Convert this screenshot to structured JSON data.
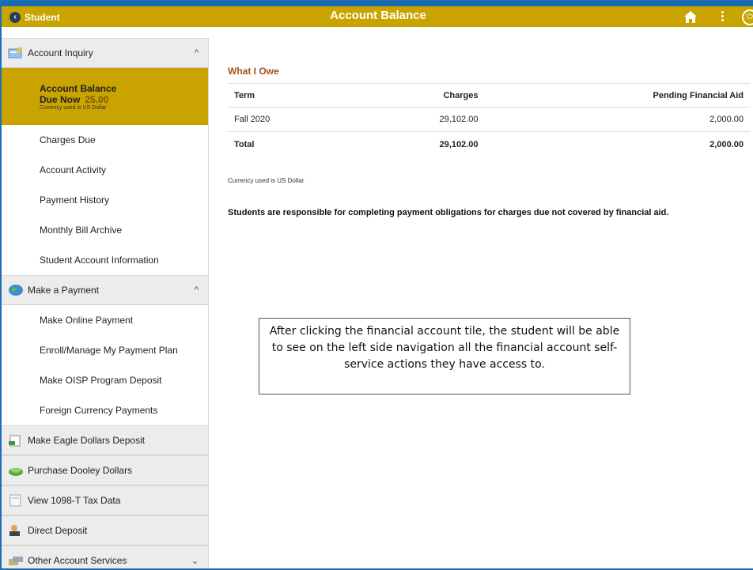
{
  "header": {
    "back_label": "Student",
    "title": "Account Balance"
  },
  "colors": {
    "header": "#c9a400",
    "accent_border": "#1f6fb4",
    "section_title": "#a0521b"
  },
  "sidebar": {
    "groups": [
      {
        "label": "Account Inquiry",
        "icon": "account-inquiry-icon",
        "expanded": true,
        "items": [
          {
            "label": "Account Balance",
            "active": true,
            "due_label": "Due Now",
            "due_amount": "25.00",
            "currency_note": "Currency used is US Dollar"
          },
          {
            "label": "Charges Due"
          },
          {
            "label": "Account Activity"
          },
          {
            "label": "Payment History"
          },
          {
            "label": "Monthly Bill Archive"
          },
          {
            "label": "Student Account Information"
          }
        ]
      },
      {
        "label": "Make a Payment",
        "icon": "payment-globe-icon",
        "expanded": true,
        "items": [
          {
            "label": "Make Online Payment"
          },
          {
            "label": "Enroll/Manage My Payment Plan"
          },
          {
            "label": "Make OISP Program Deposit"
          },
          {
            "label": "Foreign Currency Payments"
          }
        ]
      },
      {
        "label": "Make Eagle Dollars Deposit",
        "icon": "deposit-icon"
      },
      {
        "label": "Purchase Dooley Dollars",
        "icon": "cash-icon"
      },
      {
        "label": "View 1098-T Tax Data",
        "icon": "document-icon"
      },
      {
        "label": "Direct Deposit",
        "icon": "direct-deposit-icon"
      },
      {
        "label": "Other Account Services",
        "icon": "services-icon",
        "expanded": false
      }
    ]
  },
  "main": {
    "section_title": "What I Owe",
    "table": {
      "headers": [
        "Term",
        "Charges",
        "Pending Financial Aid"
      ],
      "rows": [
        [
          "Fall 2020",
          "29,102.00",
          "2,000.00"
        ]
      ],
      "total": [
        "Total",
        "29,102.00",
        "2,000.00"
      ]
    },
    "currency_note": "Currency used is US Dollar",
    "notice": "Students are responsible for completing payment obligations for charges due not covered by financial aid.",
    "callout": "After clicking the financial account tile, the student will be able to see on the left side navigation all the financial account self-service actions they have access to."
  }
}
